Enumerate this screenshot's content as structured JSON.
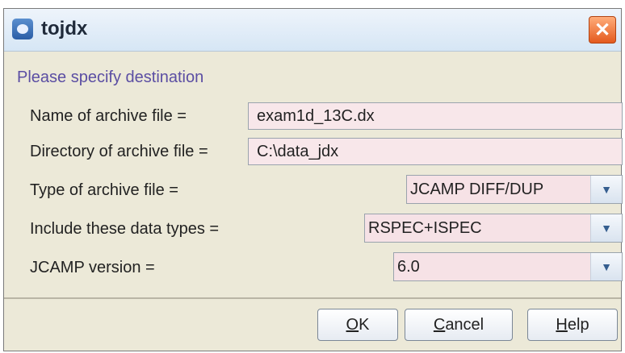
{
  "window": {
    "title": "tojdx",
    "prompt": "Please specify destination"
  },
  "form": {
    "archive_name_label": "Name of archive file =",
    "archive_name_value": "exam1d_13C.dx",
    "directory_label": "Directory of archive file =",
    "directory_value": "C:\\data_jdx",
    "type_label": "Type of archive file =",
    "type_value": "JCAMP DIFF/DUP",
    "datatypes_label": "Include these data types =",
    "datatypes_value": "RSPEC+ISPEC",
    "version_label": "JCAMP version =",
    "version_value": "6.0"
  },
  "buttons": {
    "ok_mnemonic": "O",
    "ok_rest": "K",
    "cancel_mnemonic": "C",
    "cancel_rest": "ancel",
    "help_mnemonic": "H",
    "help_rest": "elp"
  },
  "icons": {
    "app": "app-icon",
    "close": "close-icon",
    "dropdown": "chevron-down-icon"
  }
}
